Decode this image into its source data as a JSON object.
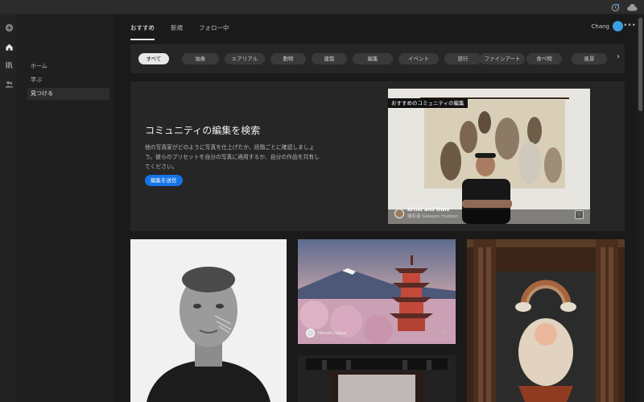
{
  "titlebar": {
    "icons": [
      "history-icon",
      "cloud-icon"
    ]
  },
  "rail": {
    "icons": [
      "add-icon",
      "home-icon",
      "library-icon",
      "people-icon"
    ]
  },
  "sidenav": {
    "items": [
      {
        "label": "ホーム",
        "active": false
      },
      {
        "label": "学ぶ",
        "active": false
      },
      {
        "label": "見つける",
        "active": true
      }
    ]
  },
  "tabs": [
    {
      "label": "おすすめ",
      "active": true
    },
    {
      "label": "新規",
      "active": false
    },
    {
      "label": "フォロー中",
      "active": false
    }
  ],
  "user": {
    "name": "Chang"
  },
  "categories": [
    {
      "label": "すべて",
      "active": true
    },
    {
      "label": "抽象",
      "active": false
    },
    {
      "label": "エアリアル",
      "active": false
    },
    {
      "label": "動物",
      "active": false
    },
    {
      "label": "建築",
      "active": false
    },
    {
      "label": "編集",
      "active": false
    },
    {
      "label": "イベント",
      "active": false
    },
    {
      "label": "旅行",
      "active": false
    },
    {
      "label": "ファインアート",
      "active": false
    },
    {
      "label": "食べ物",
      "active": false
    },
    {
      "label": "風景",
      "active": false
    }
  ],
  "hero": {
    "title": "コミュニティの編集を検索",
    "description": "他の写真家がどのように写真を仕上げたか、段階ごとに確認しましょう。彼らのプリセットを自分の写真に適用するか、自分の作品を共有してください。",
    "button_label": "編集を送信",
    "feature_label": "おすすめのコミュニティの編集",
    "feature_title": "Artist and Owls",
    "feature_author": "撮影者 Gelayes Hubbon"
  },
  "grid": {
    "card2_author": "Hiroshi Sakai"
  },
  "colors": {
    "accent": "#1473e6",
    "background": "#1a1a1a",
    "panel": "#262626"
  }
}
